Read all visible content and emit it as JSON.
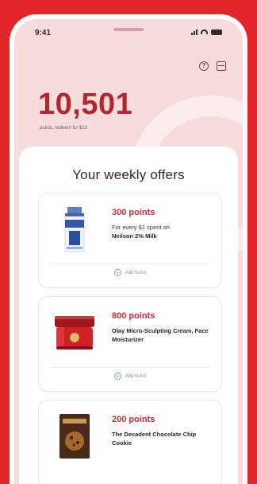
{
  "status": {
    "time": "9:41"
  },
  "header": {
    "points": "10,501",
    "points_sub": "points, redeem for $10"
  },
  "offers_title": "Your weekly offers",
  "offers": [
    {
      "points": "300 points",
      "desc_prefix": "For every $1 spent on",
      "desc_product": "Neilson 2% Milk",
      "add_label": "Add to list",
      "image": "milk-carton"
    },
    {
      "points": "800 points",
      "desc_prefix": "",
      "desc_product": "Olay Micro-Sculpting Cream, Face Moisturizer",
      "add_label": "Add to list",
      "image": "cream-jar"
    },
    {
      "points": "200 points",
      "desc_prefix": "",
      "desc_product": "The Decadent Chocolate Chip Cookie",
      "add_label": "",
      "image": "cookie-box"
    }
  ],
  "colors": {
    "background": "#e3262b",
    "accent": "#b3262c",
    "header_bg": "#f6dcdd"
  }
}
